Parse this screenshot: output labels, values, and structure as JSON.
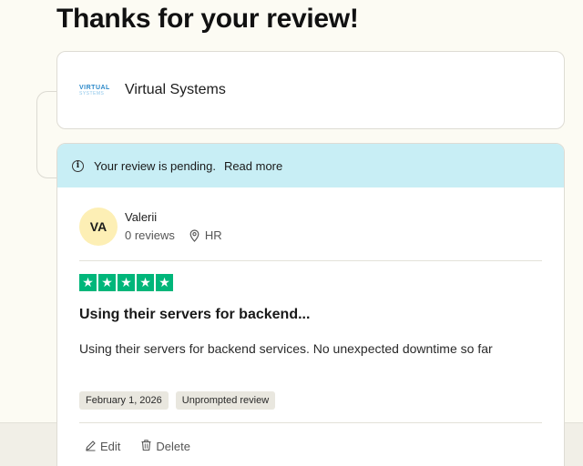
{
  "page": {
    "title": "Thanks for your review!"
  },
  "company": {
    "logo_top": "VIRTUAL",
    "logo_bottom": "SYSTEMS",
    "name": "Virtual Systems"
  },
  "banner": {
    "icon": "info-icon",
    "text": "Your review is pending.",
    "link": "Read more",
    "color": "#c8eef5"
  },
  "reviewer": {
    "initials": "VA",
    "name": "Valerii",
    "reviews": "0 reviews",
    "country": "HR"
  },
  "review": {
    "rating": 5,
    "title": "Using their servers for backend...",
    "body": "Using their servers for backend services. No unexpected downtime so far",
    "tags": [
      "February 1, 2026",
      "Unprompted review"
    ]
  },
  "actions": {
    "edit_label": "Edit",
    "delete_label": "Delete"
  },
  "colors": {
    "star": "#00b67a",
    "avatar_bg": "#fdefb5"
  }
}
